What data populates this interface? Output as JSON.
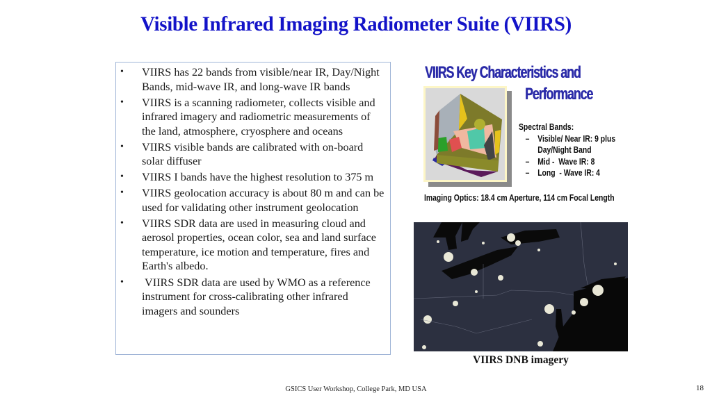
{
  "slide": {
    "title": "Visible Infrared Imaging Radiometer Suite (VIIRS)",
    "bullet_symbol": "•",
    "bullets": [
      "VIIRS has 22 bands from visible/near IR, Day/Night Bands, mid-wave IR, and long-wave IR bands",
      "VIIRS is a scanning radiometer, collects visible and infrared imagery and radiometric measurements of the land, atmosphere, cryosphere and oceans",
      "VIIRS visible bands are calibrated with on-board solar diffuser",
      "VIIRS I bands have the highest resolution to 375 m",
      "VIIRS geolocation accuracy is about 80 m and can be used for validating other instrument geolocation",
      "VIIRS SDR data are used in measuring cloud and aerosol properties, ocean color, sea and land surface temperature, ice motion and temperature, fires and Earth's albedo.",
      " VIIRS SDR data are used by WMO as a reference instrument for cross-calibrating other infrared imagers and sounders"
    ],
    "key_characteristics": {
      "title_line1": "VIIRS Key Characteristics and",
      "title_line2": "Performance",
      "spectral_heading": "Spectral Bands:",
      "dash": "–",
      "spectral_items": [
        {
          "label": "Visible/ Near IR: 9 plus",
          "continuation": "Day/Night Band"
        },
        {
          "label": "Mid -  Wave IR: 8",
          "continuation": ""
        },
        {
          "label": "Long  - Wave IR: 4",
          "continuation": ""
        }
      ],
      "optics": "Imaging Optics: 18.4 cm Aperture, 114 cm Focal Length",
      "image_subject": "viirs-instrument-3d-model"
    },
    "map": {
      "image_subject": "night-lights-northeast-us",
      "caption": "VIIRS DNB imagery"
    },
    "footer": "GSICS User Workshop, College Park, MD USA",
    "page_number": "18",
    "colors": {
      "title": "#1313c8",
      "kc_title": "#2a2aa8",
      "box_border": "#9fb4d6"
    }
  }
}
